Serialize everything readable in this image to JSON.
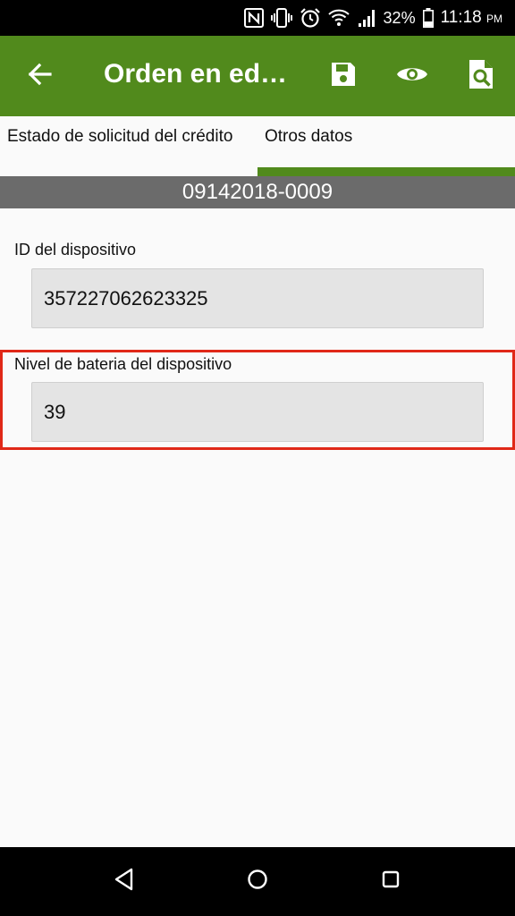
{
  "status_bar": {
    "battery_percent": "32%",
    "time": "11:18",
    "ampm": "PM",
    "icons": [
      "nfc-icon",
      "vibrate-icon",
      "alarm-icon",
      "wifi-icon",
      "signal-icon",
      "battery-icon"
    ]
  },
  "app_bar": {
    "title": "Orden en edición",
    "icons": [
      "back-arrow-icon",
      "save-icon",
      "eye-icon",
      "document-search-icon"
    ]
  },
  "tabs": [
    {
      "label": "Estado de solicitud del crédito",
      "selected": false
    },
    {
      "label": "Otros datos",
      "selected": true
    }
  ],
  "order": {
    "number": "09142018-0009"
  },
  "fields": {
    "device_id": {
      "label": "ID del dispositivo",
      "value": "357227062623325"
    },
    "battery_level": {
      "label": "Nivel de bateria del dispositivo",
      "value": "39"
    }
  },
  "colors": {
    "primary": "#518a1c",
    "header_gray": "#6b6b6b",
    "highlight": "#e02818"
  },
  "nav_bar": {
    "icons": [
      "nav-back-icon",
      "nav-home-icon",
      "nav-recents-icon"
    ]
  }
}
